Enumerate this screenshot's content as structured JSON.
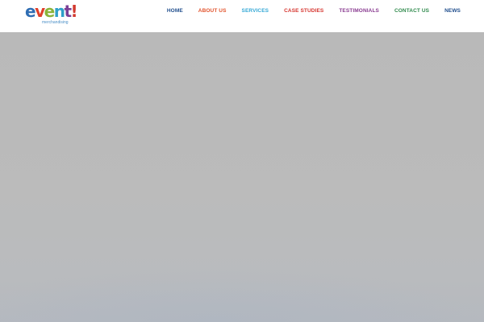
{
  "logo": {
    "letters": [
      {
        "char": "e",
        "color": "#2f6db3"
      },
      {
        "char": "v",
        "color": "#e0402a"
      },
      {
        "char": "e",
        "color": "#8ab43a"
      },
      {
        "char": "n",
        "color": "#2fa0c9"
      },
      {
        "char": "t",
        "color": "#7b3f96"
      },
      {
        "char": "!",
        "color": "#d23a2f"
      }
    ],
    "tagline": "merchandising",
    "tagline_color": "#4a8fc7"
  },
  "nav": {
    "items": [
      {
        "label": "HOME",
        "color": "#1f4d8c"
      },
      {
        "label": "ABOUT US",
        "color": "#e2532c"
      },
      {
        "label": "SERVICES",
        "color": "#36a9d6"
      },
      {
        "label": "CASE STUDIES",
        "color": "#d6352f"
      },
      {
        "label": "TESTIMONIALS",
        "color": "#8a3c91"
      },
      {
        "label": "CONTACT US",
        "color": "#2f8a4c"
      },
      {
        "label": "NEWS",
        "color": "#1f4d8c"
      }
    ]
  },
  "hero": {
    "background": "#b9b9b9"
  }
}
